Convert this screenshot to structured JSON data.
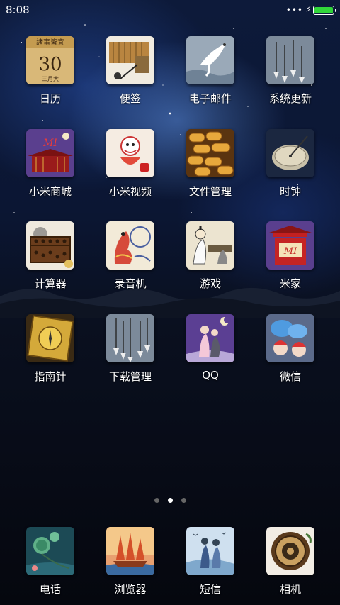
{
  "status_bar": {
    "time": "8:08",
    "dots": "•••",
    "battery_level": 1.0,
    "battery_color": "#31d63a"
  },
  "apps": [
    {
      "label": "日历",
      "icon": "calendar-icon",
      "text_top": "諸事皆宜",
      "text_mid": "30",
      "text_bot": "三月大"
    },
    {
      "label": "便签",
      "icon": "notes-icon"
    },
    {
      "label": "电子邮件",
      "icon": "email-icon"
    },
    {
      "label": "系统更新",
      "icon": "update-icon"
    },
    {
      "label": "小米商城",
      "icon": "mi-store-icon",
      "text_mid": "MI"
    },
    {
      "label": "小米视频",
      "icon": "mi-video-icon"
    },
    {
      "label": "文件管理",
      "icon": "file-manager-icon"
    },
    {
      "label": "时钟",
      "icon": "clock-icon"
    },
    {
      "label": "计算器",
      "icon": "calculator-icon"
    },
    {
      "label": "录音机",
      "icon": "recorder-icon"
    },
    {
      "label": "游戏",
      "icon": "games-icon"
    },
    {
      "label": "米家",
      "icon": "mijia-icon",
      "text_mid": "MI"
    },
    {
      "label": "指南针",
      "icon": "compass-icon"
    },
    {
      "label": "下载管理",
      "icon": "downloads-icon"
    },
    {
      "label": "QQ",
      "icon": "qq-icon"
    },
    {
      "label": "微信",
      "icon": "wechat-icon"
    }
  ],
  "page_indicator": {
    "count": 3,
    "active_index": 1
  },
  "dock": [
    {
      "label": "电话",
      "icon": "phone-icon"
    },
    {
      "label": "浏览器",
      "icon": "browser-icon"
    },
    {
      "label": "短信",
      "icon": "messages-icon"
    },
    {
      "label": "相机",
      "icon": "camera-icon"
    }
  ]
}
